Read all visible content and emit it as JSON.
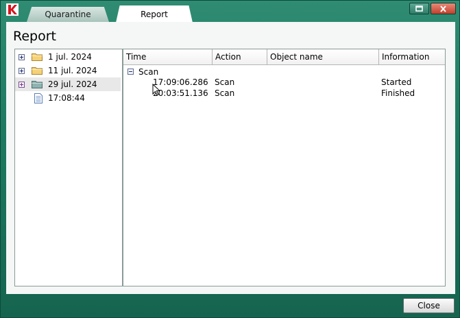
{
  "tabs": [
    {
      "label": "Quarantine",
      "active": false
    },
    {
      "label": "Report",
      "active": true
    }
  ],
  "title_bar": {
    "logo": "kaspersky-k-icon",
    "buttons": [
      "restore-icon",
      "close-icon"
    ]
  },
  "page_title": "Report",
  "tree": {
    "items": [
      {
        "label": "1 jul. 2024",
        "icon": "folder-icon",
        "expander": "plus"
      },
      {
        "label": "11 jul. 2024",
        "icon": "folder-icon",
        "expander": "plus"
      },
      {
        "label": "29 jul. 2024",
        "icon": "folder-icon",
        "expander": "plus",
        "selected": true
      },
      {
        "label": "17:08:44",
        "icon": "document-icon"
      }
    ]
  },
  "table": {
    "columns": [
      "Time",
      "Action",
      "Object name",
      "Information"
    ],
    "group": {
      "label": "Scan",
      "expander": "minus"
    },
    "rows": [
      {
        "time": "17:09:06.286",
        "action": "Scan",
        "object": "",
        "info": "Started"
      },
      {
        "time": "20:03:51.136",
        "action": "Scan",
        "object": "",
        "info": "Finished"
      }
    ]
  },
  "footer": {
    "close_label": "Close"
  },
  "colors": {
    "frame": "#1d7a60",
    "content_bg": "#f4f7f6"
  }
}
